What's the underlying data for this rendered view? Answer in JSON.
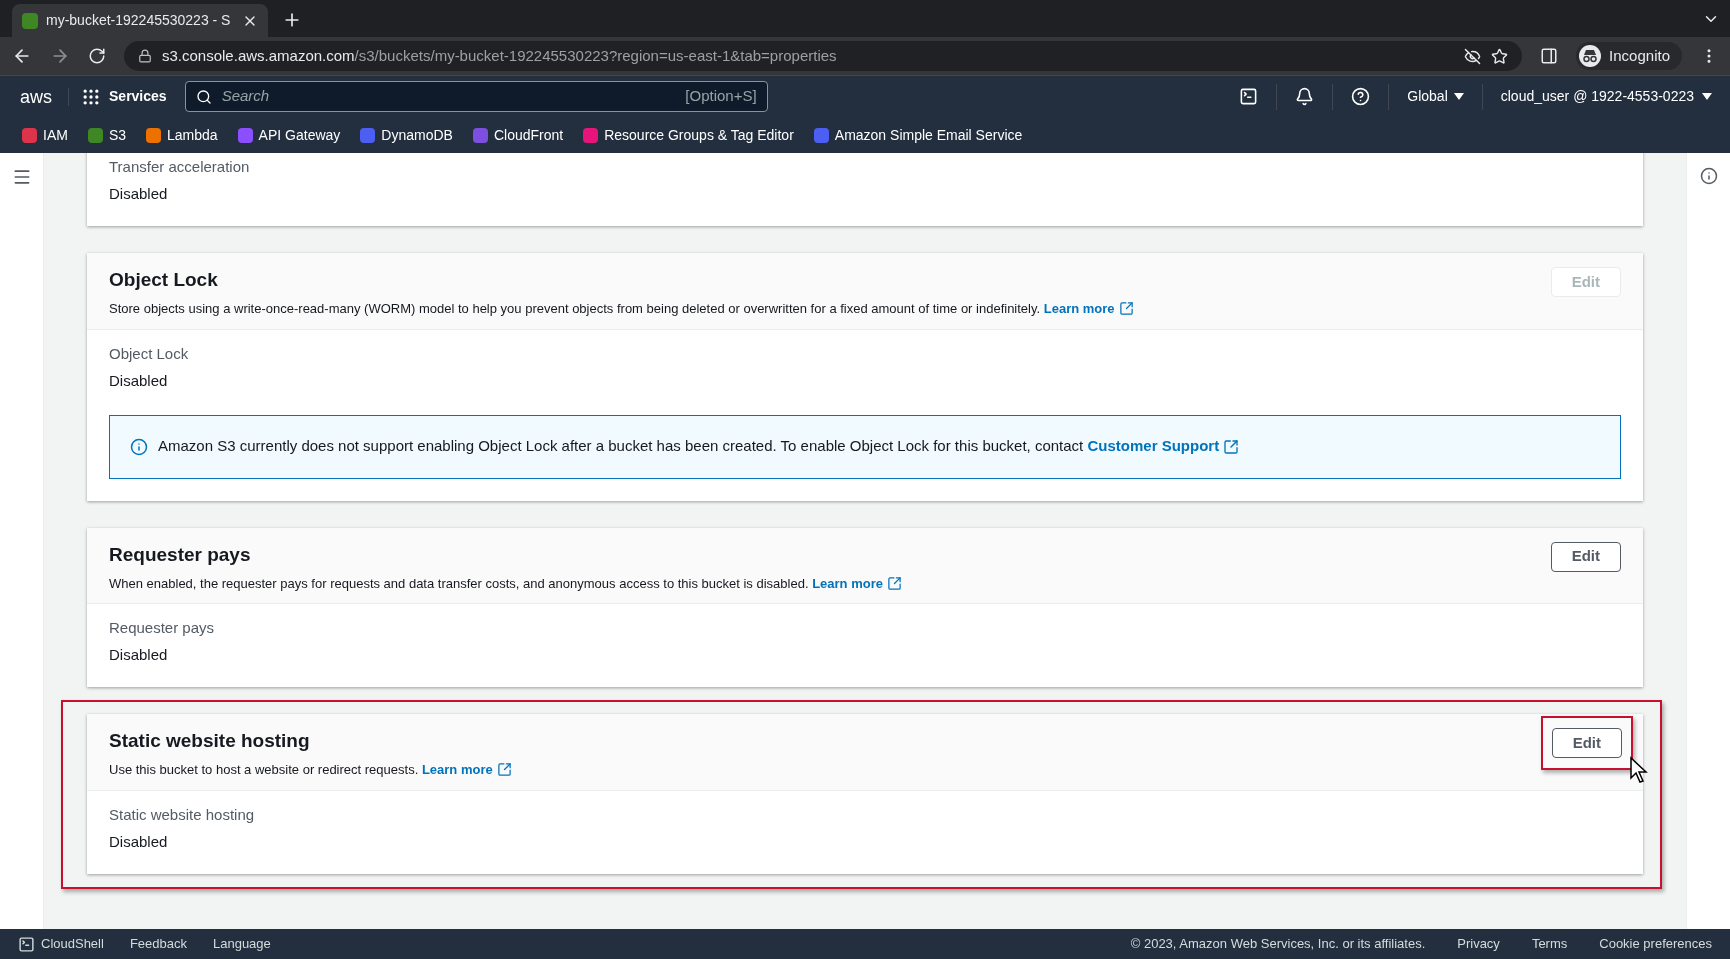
{
  "browser": {
    "tab": {
      "title": "my-bucket-192245530223 - S"
    },
    "url": {
      "host": "s3.console.aws.amazon.com",
      "path": "/s3/buckets/my-bucket-192245530223?region=us-east-1&tab=properties"
    },
    "profile": "Incognito"
  },
  "console_nav": {
    "logo": "aws",
    "services": "Services",
    "search": {
      "placeholder": "Search",
      "shortcut": "[Option+S]"
    },
    "region": "Global",
    "account": "cloud_user @ 1922-4553-0223"
  },
  "favorites": [
    {
      "label": "IAM",
      "color": "#dd344c"
    },
    {
      "label": "S3",
      "color": "#3f8624"
    },
    {
      "label": "Lambda",
      "color": "#ed7100"
    },
    {
      "label": "API Gateway",
      "color": "#8c4fff"
    },
    {
      "label": "DynamoDB",
      "color": "#4d5ff3"
    },
    {
      "label": "CloudFront",
      "color": "#7d4fe0"
    },
    {
      "label": "Resource Groups & Tag Editor",
      "color": "#e7157b"
    },
    {
      "label": "Amazon Simple Email Service",
      "color": "#4d5ff3"
    }
  ],
  "sections": [
    {
      "field_label": "Transfer acceleration",
      "field_value": "Disabled",
      "highlighted": false
    },
    {
      "title": "Object Lock",
      "description": "Store objects using a write-once-read-many (WORM) model to help you prevent objects from being deleted or overwritten for a fixed amount of time or indefinitely.",
      "link": "Learn more",
      "edit": {
        "label": "Edit",
        "disabled": true,
        "highlighted": false
      },
      "field_label": "Object Lock",
      "field_value": "Disabled",
      "alert": {
        "text": "Amazon S3 currently does not support enabling Object Lock after a bucket has been created. To enable Object Lock for this bucket, contact",
        "link": "Customer Support"
      },
      "highlighted": false
    },
    {
      "title": "Requester pays",
      "description": "When enabled, the requester pays for requests and data transfer costs, and anonymous access to this bucket is disabled.",
      "link": "Learn more",
      "edit": {
        "label": "Edit",
        "disabled": false,
        "highlighted": false
      },
      "field_label": "Requester pays",
      "field_value": "Disabled",
      "highlighted": false
    },
    {
      "title": "Static website hosting",
      "description": "Use this bucket to host a website or redirect requests.",
      "link": "Learn more",
      "edit": {
        "label": "Edit",
        "disabled": false,
        "highlighted": true
      },
      "field_label": "Static website hosting",
      "field_value": "Disabled",
      "highlighted": true
    }
  ],
  "footer": {
    "cloudshell": "CloudShell",
    "feedback": "Feedback",
    "language": "Language",
    "copyright": "© 2023, Amazon Web Services, Inc. or its affiliates.",
    "links": [
      "Privacy",
      "Terms",
      "Cookie preferences"
    ]
  }
}
